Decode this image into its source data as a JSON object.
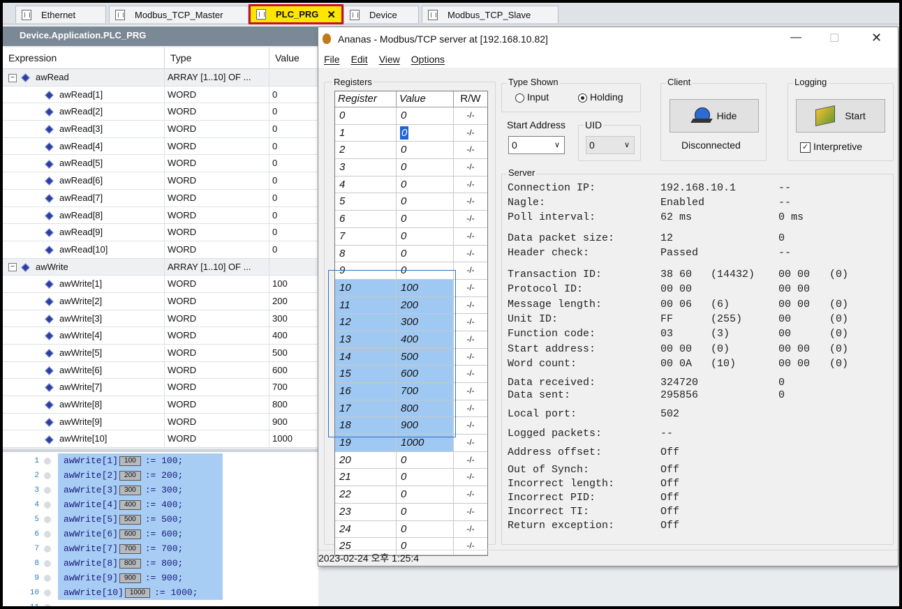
{
  "tabs": [
    {
      "label": "Ethernet"
    },
    {
      "label": "Modbus_TCP_Master"
    },
    {
      "label": "PLC_PRG"
    },
    {
      "label": "Device"
    },
    {
      "label": "Modbus_TCP_Slave"
    }
  ],
  "left": {
    "header": "Device.Application.PLC_PRG",
    "columns": [
      "Expression",
      "Type",
      "Value"
    ],
    "rows": [
      {
        "expr": "awRead",
        "type": "ARRAY [1..10] OF ...",
        "value": "",
        "parent": true
      },
      {
        "expr": "awRead[1]",
        "type": "WORD",
        "value": "0"
      },
      {
        "expr": "awRead[2]",
        "type": "WORD",
        "value": "0"
      },
      {
        "expr": "awRead[3]",
        "type": "WORD",
        "value": "0"
      },
      {
        "expr": "awRead[4]",
        "type": "WORD",
        "value": "0"
      },
      {
        "expr": "awRead[5]",
        "type": "WORD",
        "value": "0"
      },
      {
        "expr": "awRead[6]",
        "type": "WORD",
        "value": "0"
      },
      {
        "expr": "awRead[7]",
        "type": "WORD",
        "value": "0"
      },
      {
        "expr": "awRead[8]",
        "type": "WORD",
        "value": "0"
      },
      {
        "expr": "awRead[9]",
        "type": "WORD",
        "value": "0"
      },
      {
        "expr": "awRead[10]",
        "type": "WORD",
        "value": "0"
      },
      {
        "expr": "awWrite",
        "type": "ARRAY [1..10] OF ...",
        "value": "",
        "parent": true
      },
      {
        "expr": "awWrite[1]",
        "type": "WORD",
        "value": "100"
      },
      {
        "expr": "awWrite[2]",
        "type": "WORD",
        "value": "200"
      },
      {
        "expr": "awWrite[3]",
        "type": "WORD",
        "value": "300"
      },
      {
        "expr": "awWrite[4]",
        "type": "WORD",
        "value": "400"
      },
      {
        "expr": "awWrite[5]",
        "type": "WORD",
        "value": "500"
      },
      {
        "expr": "awWrite[6]",
        "type": "WORD",
        "value": "600"
      },
      {
        "expr": "awWrite[7]",
        "type": "WORD",
        "value": "700"
      },
      {
        "expr": "awWrite[8]",
        "type": "WORD",
        "value": "800"
      },
      {
        "expr": "awWrite[9]",
        "type": "WORD",
        "value": "900"
      },
      {
        "expr": "awWrite[10]",
        "type": "WORD",
        "value": "1000"
      }
    ],
    "code": [
      {
        "n": "1",
        "pre": "awWrite[1]",
        "val": "100",
        "post": ":= 100;"
      },
      {
        "n": "2",
        "pre": "awWrite[2]",
        "val": "200",
        "post": ":= 200;"
      },
      {
        "n": "3",
        "pre": "awWrite[3]",
        "val": "300",
        "post": ":= 300;"
      },
      {
        "n": "4",
        "pre": "awWrite[4]",
        "val": "400",
        "post": ":= 400;"
      },
      {
        "n": "5",
        "pre": "awWrite[5]",
        "val": "500",
        "post": ":= 500;"
      },
      {
        "n": "6",
        "pre": "awWrite[6]",
        "val": "600",
        "post": ":= 600;"
      },
      {
        "n": "7",
        "pre": "awWrite[7]",
        "val": "700",
        "post": ":= 700;"
      },
      {
        "n": "8",
        "pre": "awWrite[8]",
        "val": "800",
        "post": ":= 800;"
      },
      {
        "n": "9",
        "pre": "awWrite[9]",
        "val": "900",
        "post": ":= 900;"
      },
      {
        "n": "10",
        "pre": "awWrite[10]",
        "val": "1000",
        "post": ":= 1000;"
      },
      {
        "n": "11",
        "pre": "",
        "val": "",
        "post": ""
      }
    ]
  },
  "ananas": {
    "title": "Ananas - Modbus/TCP server at [192.168.10.82]",
    "menu": [
      "File",
      "Edit",
      "View",
      "Options"
    ],
    "registers_label": "Registers",
    "reg_columns": [
      "Register",
      "Value",
      "R/W"
    ],
    "registers": [
      {
        "reg": "0",
        "val": "0",
        "rw": "-/-"
      },
      {
        "reg": "1",
        "val": "0",
        "rw": "-/-"
      },
      {
        "reg": "2",
        "val": "0",
        "rw": "-/-"
      },
      {
        "reg": "3",
        "val": "0",
        "rw": "-/-"
      },
      {
        "reg": "4",
        "val": "0",
        "rw": "-/-"
      },
      {
        "reg": "5",
        "val": "0",
        "rw": "-/-"
      },
      {
        "reg": "6",
        "val": "0",
        "rw": "-/-"
      },
      {
        "reg": "7",
        "val": "0",
        "rw": "-/-"
      },
      {
        "reg": "8",
        "val": "0",
        "rw": "-/-"
      },
      {
        "reg": "9",
        "val": "0",
        "rw": "-/-"
      },
      {
        "reg": "10",
        "val": "100",
        "rw": "-/-",
        "sel": true
      },
      {
        "reg": "11",
        "val": "200",
        "rw": "-/-",
        "sel": true
      },
      {
        "reg": "12",
        "val": "300",
        "rw": "-/-",
        "sel": true
      },
      {
        "reg": "13",
        "val": "400",
        "rw": "-/-",
        "sel": true
      },
      {
        "reg": "14",
        "val": "500",
        "rw": "-/-",
        "sel": true
      },
      {
        "reg": "15",
        "val": "600",
        "rw": "-/-",
        "sel": true
      },
      {
        "reg": "16",
        "val": "700",
        "rw": "-/-",
        "sel": true
      },
      {
        "reg": "17",
        "val": "800",
        "rw": "-/-",
        "sel": true
      },
      {
        "reg": "18",
        "val": "900",
        "rw": "-/-",
        "sel": true
      },
      {
        "reg": "19",
        "val": "1000",
        "rw": "-/-",
        "sel": true
      },
      {
        "reg": "20",
        "val": "0",
        "rw": "-/-"
      },
      {
        "reg": "21",
        "val": "0",
        "rw": "-/-"
      },
      {
        "reg": "22",
        "val": "0",
        "rw": "-/-"
      },
      {
        "reg": "23",
        "val": "0",
        "rw": "-/-"
      },
      {
        "reg": "24",
        "val": "0",
        "rw": "-/-"
      },
      {
        "reg": "25",
        "val": "0",
        "rw": "-/-"
      }
    ],
    "type_shown": {
      "label": "Type Shown",
      "input": "Input",
      "holding": "Holding",
      "selected": "Holding"
    },
    "start_address": {
      "label": "Start Address",
      "value": "0"
    },
    "uid": {
      "label": "UID",
      "value": "0"
    },
    "client": {
      "label": "Client",
      "button": "Hide",
      "status": "Disconnected"
    },
    "logging": {
      "label": "Logging",
      "button": "Start",
      "checkbox": "Interpretive",
      "checked": true
    },
    "server_label": "Server",
    "server_rows": [
      {
        "k": "Connection IP:",
        "a": "192.168.10.1",
        "b": "",
        "c": "--",
        "d": ""
      },
      {
        "k": "Nagle:",
        "a": "Enabled",
        "b": "",
        "c": "--",
        "d": ""
      },
      {
        "k": "Poll interval:",
        "a": "62 ms",
        "b": "",
        "c": "0 ms",
        "d": ""
      },
      {
        "k": "Data packet size:",
        "a": "12",
        "b": "",
        "c": "0",
        "d": ""
      },
      {
        "k": "Header check:",
        "a": "Passed",
        "b": "",
        "c": "--",
        "d": ""
      },
      {
        "k": "Transaction ID:",
        "a": "38 60",
        "b": "(14432)",
        "c": "00 00",
        "d": "(0)"
      },
      {
        "k": "Protocol ID:",
        "a": "00 00",
        "b": "",
        "c": "00 00",
        "d": ""
      },
      {
        "k": "Message length:",
        "a": "00 06",
        "b": "(6)",
        "c": "00 00",
        "d": "(0)"
      },
      {
        "k": "Unit ID:",
        "a": "FF",
        "b": "(255)",
        "c": "00",
        "d": "(0)"
      },
      {
        "k": "Function code:",
        "a": "03",
        "b": "(3)",
        "c": "00",
        "d": "(0)"
      },
      {
        "k": "Start address:",
        "a": "00 00",
        "b": "(0)",
        "c": "00 00",
        "d": "(0)"
      },
      {
        "k": "Word count:",
        "a": "00 0A",
        "b": "(10)",
        "c": "00 00",
        "d": "(0)"
      },
      {
        "k": "Data received:",
        "a": "324720",
        "b": "",
        "c": "0",
        "d": ""
      },
      {
        "k": "Data sent:",
        "a": "295856",
        "b": "",
        "c": "0",
        "d": ""
      },
      {
        "k": "Local port:",
        "a": "502",
        "b": "",
        "c": "",
        "d": ""
      },
      {
        "k": "Logged packets:",
        "a": "--",
        "b": "",
        "c": "",
        "d": ""
      },
      {
        "k": "Address offset:",
        "a": "Off",
        "b": "",
        "c": "",
        "d": ""
      },
      {
        "k": "Out of Synch:",
        "a": "Off",
        "b": "",
        "c": "",
        "d": ""
      },
      {
        "k": "Incorrect length:",
        "a": "Off",
        "b": "",
        "c": "",
        "d": ""
      },
      {
        "k": "Incorrect PID:",
        "a": "Off",
        "b": "",
        "c": "",
        "d": ""
      },
      {
        "k": "Incorrect TI:",
        "a": "Off",
        "b": "",
        "c": "",
        "d": ""
      },
      {
        "k": "Return exception:",
        "a": "Off",
        "b": "",
        "c": "",
        "d": ""
      }
    ],
    "status": "2023-02-24 오후 1:25:4"
  }
}
